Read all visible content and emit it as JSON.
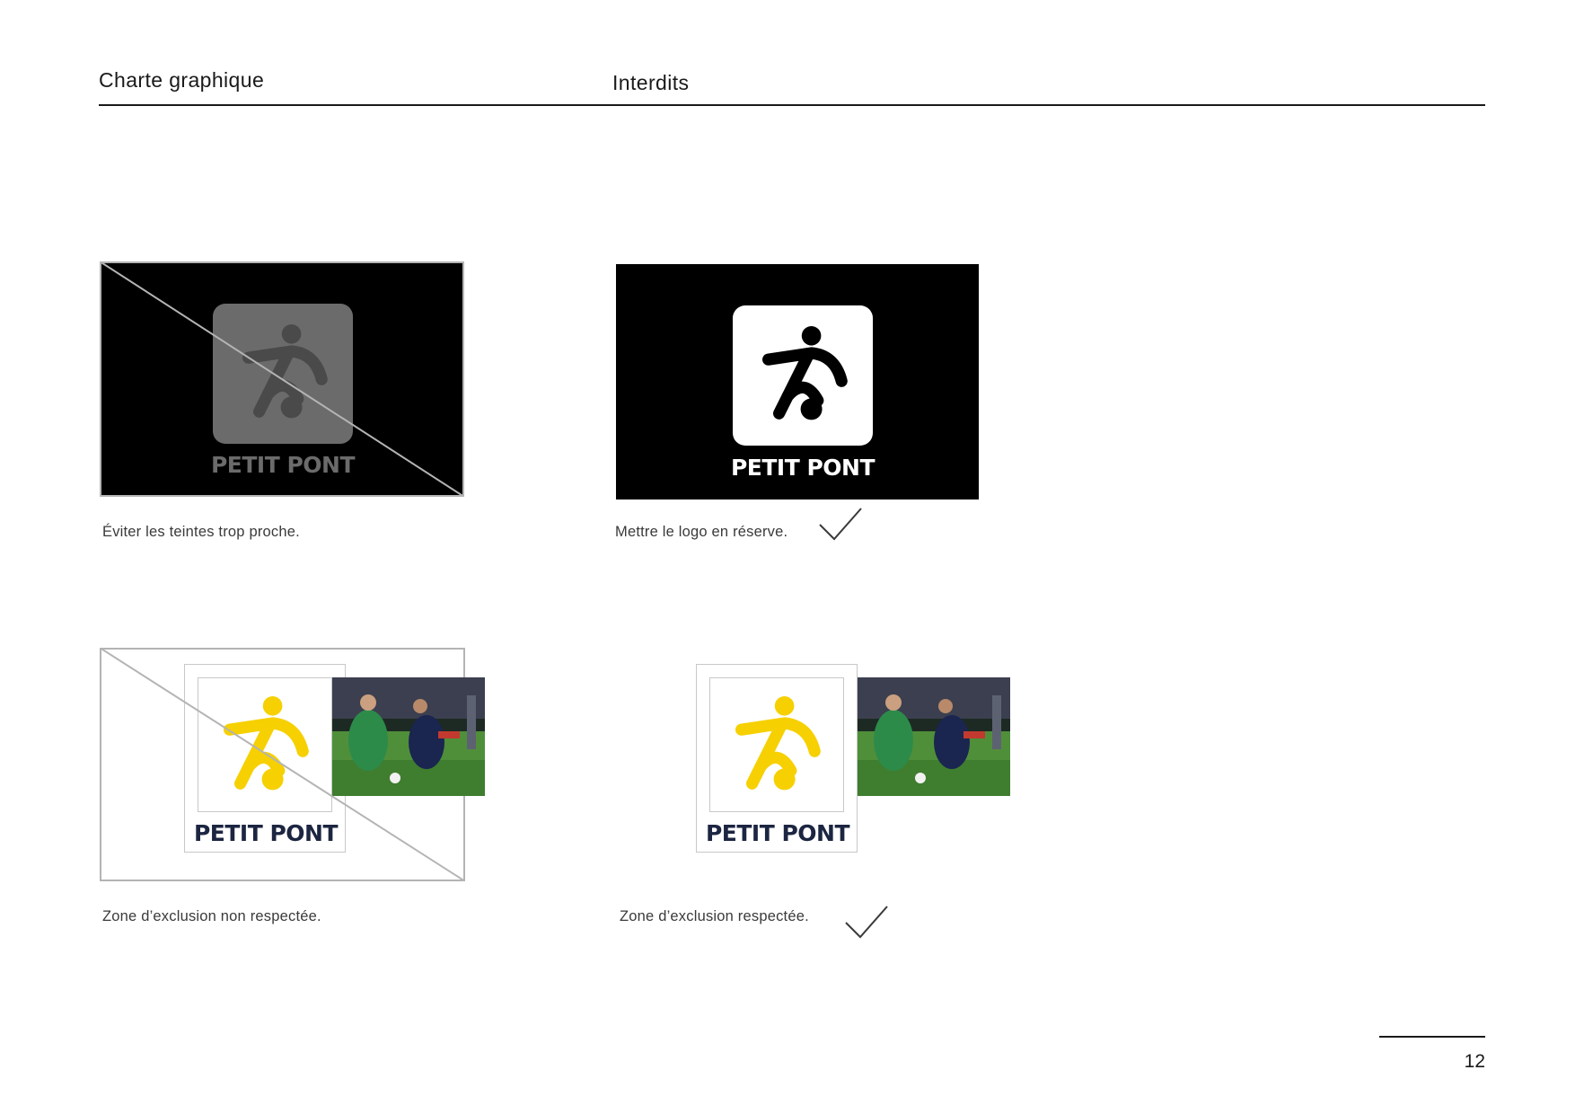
{
  "header": {
    "left_title": "Charte graphique",
    "section_title": "Interdits"
  },
  "logo": {
    "wordmark": "PETIT PONT",
    "icon": "footballer-kicking-ball-icon"
  },
  "examples": [
    {
      "caption": "Éviter les teintes trop proche.",
      "status": "forbidden"
    },
    {
      "caption": "Mettre le logo en réserve.",
      "status": "correct"
    },
    {
      "caption": "Zone d’exclusion non respectée.",
      "status": "forbidden"
    },
    {
      "caption": "Zone d’exclusion respectée.",
      "status": "correct"
    }
  ],
  "colors": {
    "brand_yellow": "#f6d000",
    "brand_navy": "#1c2541",
    "tone_gray": "#6b6b6b",
    "black": "#000000",
    "strike_gray": "#b4b4b4"
  },
  "footer": {
    "page_number": "12"
  }
}
